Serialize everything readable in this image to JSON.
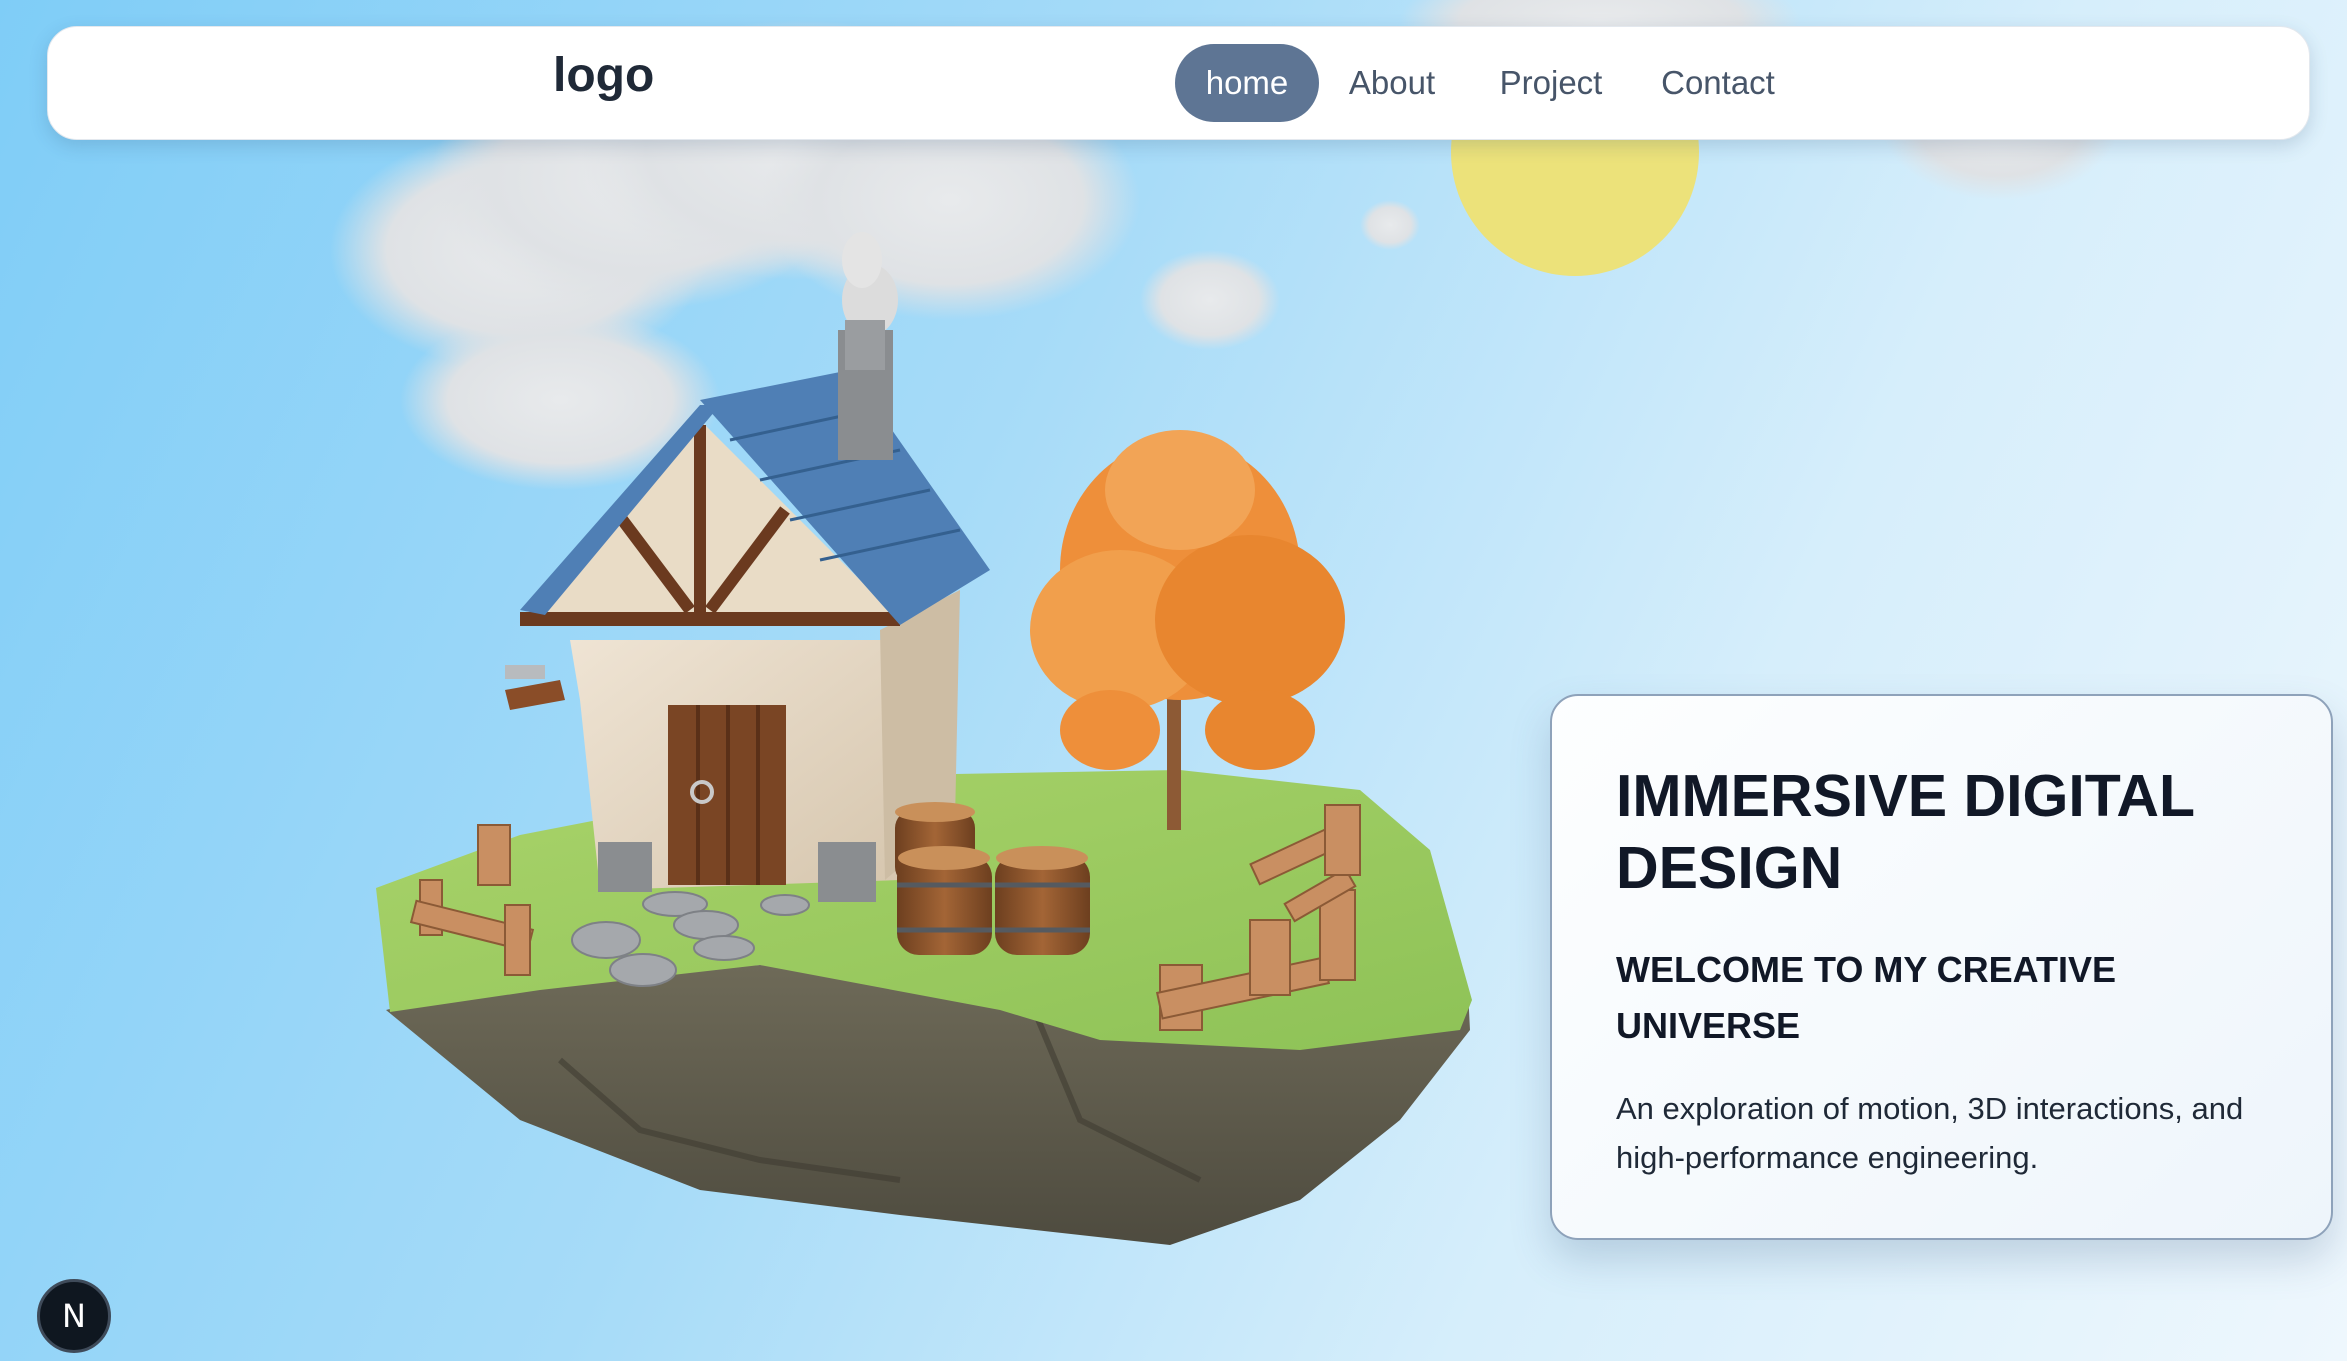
{
  "nav": {
    "logo": "logo",
    "items": [
      {
        "label": "home",
        "active": true
      },
      {
        "label": "About",
        "active": false
      },
      {
        "label": "Project",
        "active": false
      },
      {
        "label": "Contact",
        "active": false
      }
    ]
  },
  "hero": {
    "title": "IMMERSIVE DIGITAL DESIGN",
    "subtitle": "WELCOME TO MY CREATIVE UNIVERSE",
    "description": "An exploration of motion, 3D interactions, and high-performance engineering."
  },
  "dev_badge": {
    "letter": "N"
  },
  "colors": {
    "nav_active_bg": "#5e7594",
    "sun": "#ece27a",
    "grass": "#9ccb5e",
    "roof": "#4f7fb5",
    "tree": "#ee8f3a"
  }
}
